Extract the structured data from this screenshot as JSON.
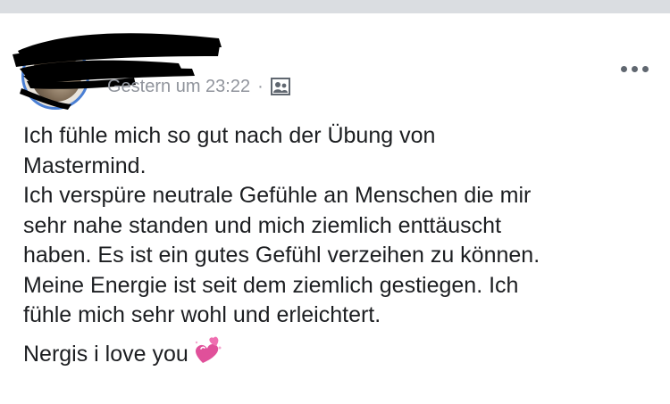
{
  "post": {
    "author_name": "",
    "timestamp": "Gestern um 23:22",
    "separator": "·",
    "audience_icon": "friends-icon",
    "more_icon": "more-dots-icon",
    "body_lines": [
      "Ich fühle mich so gut nach der Übung von",
      "Mastermind.",
      "Ich verspüre neutrale Gefühle an Menschen die mir",
      "sehr nahe standen und mich ziemlich enttäuscht",
      "haben. Es ist ein gutes Gefühl verzeihen zu können.",
      "Meine Energie ist seit dem ziemlich gestiegen. Ich",
      "fühle mich sehr wohl und erleichtert."
    ],
    "closing_text": "Nergis i love you",
    "closing_emoji": "sparkling-heart-emoji"
  },
  "colors": {
    "text": "#1c1e21",
    "meta": "#90949c",
    "avatar_ring": "#4a7fd4",
    "emoji_heart": "#e0509a"
  }
}
